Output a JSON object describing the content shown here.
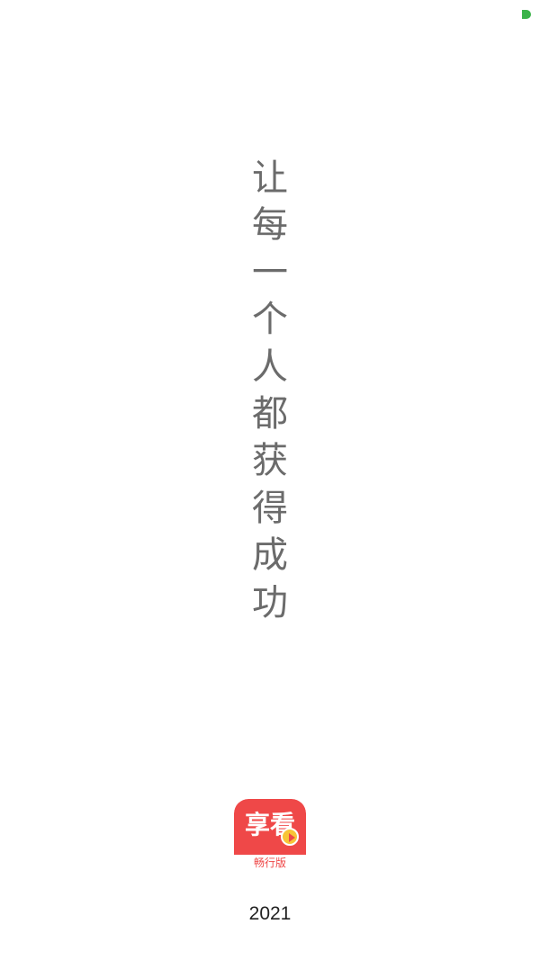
{
  "status_indicator": {
    "color": "#3bb34a"
  },
  "slogan": {
    "chars": [
      "让",
      "每",
      "一",
      "个",
      "人",
      "都",
      "获",
      "得",
      "成",
      "功"
    ],
    "color": "#6b6b6b"
  },
  "logo": {
    "title": "享看",
    "subtitle": "畅行版",
    "brand_color": "#ef4848",
    "play_color": "#f8c437",
    "icon": "play-icon"
  },
  "footer": {
    "year": "2021"
  }
}
